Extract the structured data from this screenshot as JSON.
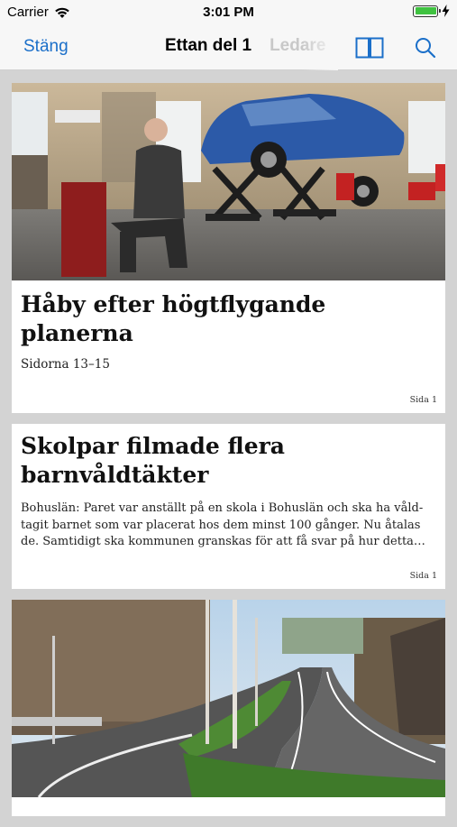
{
  "status": {
    "carrier": "Carrier",
    "time": "3:01 PM",
    "battery_level": 1.0,
    "battery_color": "#3fc240"
  },
  "nav": {
    "close_label": "Stäng",
    "tabs": [
      {
        "label": "Ettan del 1",
        "active": true
      },
      {
        "label": "Ledare",
        "active": false
      }
    ],
    "icons": [
      "two-page-view-icon",
      "search-icon"
    ],
    "accent_color": "#1b6fc9"
  },
  "articles": [
    {
      "image": "garage-mechanic-photo",
      "headline": "Håby efter högtflygande planerna",
      "subline": "Sidorna 13–15",
      "page_ref": "Sida 1"
    },
    {
      "headline_line1": "Skolpar filmade flera",
      "headline_line2": "barnvåldtäkter",
      "body_line1": "Bohuslän: Paret var anställt på en skola i Bohuslän och ska ha våld-",
      "body_line2": "tagit barnet som var placerat hos dem minst 100 gånger. Nu åtalas",
      "body_line3": "de. Samtidigt ska kommunen granskas för att få svar på hur detta…",
      "page_ref": "Sida 1"
    },
    {
      "image": "road-landscape-photo"
    }
  ]
}
